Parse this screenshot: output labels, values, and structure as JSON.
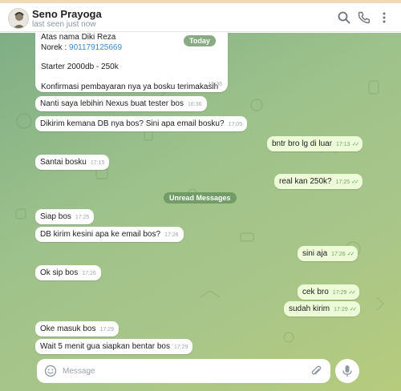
{
  "header": {
    "name": "Seno Prayoga",
    "status": "last seen just now",
    "icons": [
      "search-icon",
      "phone-icon",
      "more-vertical-icon"
    ]
  },
  "first_message": {
    "lines": [
      "Atas nama Diki Reza",
      "Norek : ",
      "Starter 2000db - 250k",
      "Konfirmasi pembayaran nya ya bosku terimakasih"
    ],
    "account_number": "901179125669",
    "time": "16:36"
  },
  "date_pill": "Today",
  "unread_label": "Unread Messages",
  "messages": [
    {
      "text": "Nanti saya lebihin Nexus buat tester bos",
      "time": "16:36",
      "side": "in"
    },
    {
      "text": "Dikirim kemana DB nya bos? Sini apa email bosku?",
      "time": "17:05",
      "side": "in"
    },
    {
      "text": "bntr bro lg di luar",
      "time": "17:13",
      "side": "out"
    },
    {
      "text": "Santai bosku",
      "time": "17:15",
      "side": "in"
    },
    {
      "text": "real kan 250k?",
      "time": "17:25",
      "side": "out"
    },
    {
      "text": "Siap bos",
      "time": "17:25",
      "side": "in"
    },
    {
      "text": "DB kirim kesini apa ke email bos?",
      "time": "17:26",
      "side": "in"
    },
    {
      "text": "sini aja",
      "time": "17:26",
      "side": "out"
    },
    {
      "text": "Ok sip bos",
      "time": "17:26",
      "side": "in"
    },
    {
      "text": "cek bro",
      "time": "17:29",
      "side": "out"
    },
    {
      "text": "sudah kirim",
      "time": "17:29",
      "side": "out"
    },
    {
      "text": "Oke masuk bos",
      "time": "17:29",
      "side": "in"
    },
    {
      "text": "Wait 5 menit gua siapkan bentar bos",
      "time": "17:29",
      "side": "in"
    }
  ],
  "composer": {
    "placeholder": "Message"
  },
  "colors": {
    "accent_green": "#4fae4e",
    "out_bubble": "#eefbd8",
    "link": "#3a8ad3"
  }
}
